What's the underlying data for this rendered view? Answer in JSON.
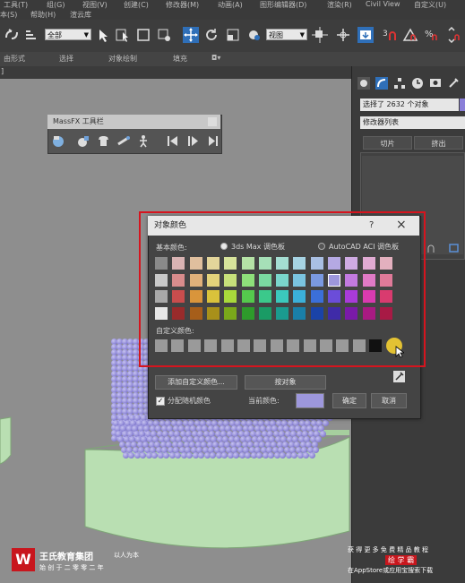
{
  "menubar": {
    "items": [
      "工具(T)",
      "组(G)",
      "视图(V)",
      "创建(C)",
      "修改器(M)",
      "动画(A)",
      "图形编辑器(D)",
      "渲染(R)",
      "Civil View",
      "自定义(U)"
    ],
    "row2": [
      "本(S)",
      "帮助(H)",
      "渲云库"
    ]
  },
  "toolbar": {
    "selection_filter": "全部",
    "ref_coord": "视图"
  },
  "ribbon": {
    "items": [
      "由形式",
      "选择",
      "对象绘制",
      "填充"
    ]
  },
  "viewport": {
    "corner_label": "]"
  },
  "massfx": {
    "title": "MassFX 工具栏"
  },
  "right_panel": {
    "selection_info": "选择了 2632 个对象",
    "modifier_list": "修改器列表",
    "buttons": [
      "切片",
      "挤出"
    ]
  },
  "dialog": {
    "title": "对象颜色",
    "help": "?",
    "close": "×",
    "basic_colors_label": "基本颜色:",
    "radio_3dsmax": "3ds Max 调色板",
    "radio_autocad": "AutoCAD ACI 调色板",
    "custom_colors_label": "自定义颜色:",
    "add_custom_button": "添加自定义颜色...",
    "by_object_button": "按对象",
    "random_checkbox_label": "分配随机颜色",
    "current_color_label": "当前颜色:",
    "ok_button": "确定",
    "cancel_button": "取消",
    "current_color": "#9d97dc",
    "basic_colors": [
      [
        "#8a8a8a",
        "#d9b3b3",
        "#e0bf9e",
        "#e3d59a",
        "#d7e39b",
        "#b5e3a6",
        "#a6e0b8",
        "#a4ddd2",
        "#a6d3e3",
        "#a9bfe3",
        "#b5a9e3",
        "#cfabe3",
        "#e0abd3",
        "#e3b0be"
      ],
      [
        "#c9c9c9",
        "#d98c8c",
        "#e0b07a",
        "#e3d27a",
        "#c7e07a",
        "#8ee07a",
        "#7ad9a1",
        "#7ad6cc",
        "#7ac4e0",
        "#7a99e0",
        "#9d97dc",
        "#c27ae0",
        "#e07ac6",
        "#e07a99"
      ],
      [
        "#a9a9a9",
        "#c94d4d",
        "#d9953b",
        "#d9c23b",
        "#a9d93b",
        "#55c94d",
        "#3bc98b",
        "#3bc9bc",
        "#3bb0d9",
        "#3b6fd9",
        "#6b4dd9",
        "#a93bd9",
        "#d93bb0",
        "#d93b6f"
      ],
      [
        "#e6e6e6",
        "#992b2b",
        "#a65e1a",
        "#a8901a",
        "#7aa81a",
        "#2e9b2b",
        "#1a9b65",
        "#1a9b8f",
        "#1a7fa8",
        "#1a43a8",
        "#3f2ba8",
        "#7a1aa8",
        "#a81a82",
        "#a81a45"
      ]
    ],
    "custom_colors": [
      "#9a9a9a",
      "#9a9a9a",
      "#9a9a9a",
      "#9a9a9a",
      "#9a9a9a",
      "#9a9a9a",
      "#9a9a9a",
      "#9a9a9a",
      "#9a9a9a",
      "#9a9a9a",
      "#9a9a9a",
      "#9a9a9a",
      "#9a9a9a",
      "#111111",
      "#e3c233"
    ]
  },
  "watermark": {
    "brand": "王氏教育集团",
    "slogan": "以人为本",
    "sub": "始 创 于 二 零 零 二 年",
    "right_line1": "获 得 更 多 免 费 精 品 教 程",
    "right_logo": "绘 学 霸",
    "right_line3": "在AppStore或应用宝搜索下载"
  }
}
